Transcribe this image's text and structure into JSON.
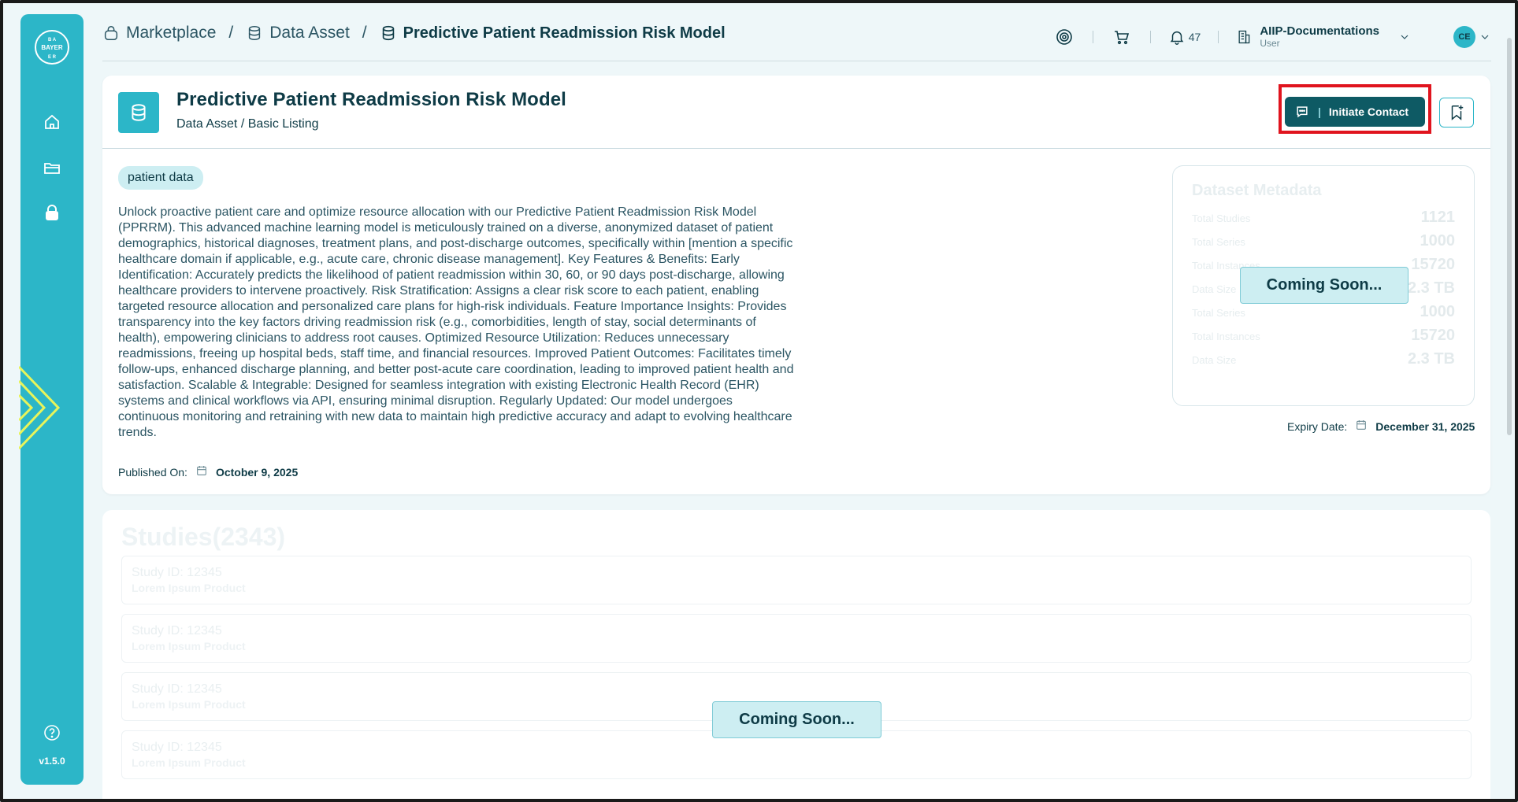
{
  "sidebar": {
    "logo_text": "BAYER",
    "icons": [
      "home-icon",
      "folder-icon",
      "marketplace-icon"
    ],
    "help_icon": "help-icon",
    "version": "v1.5.0"
  },
  "breadcrumb": {
    "items": [
      {
        "label": "Marketplace",
        "icon": "shopping-bag-icon"
      },
      {
        "label": "Data Asset",
        "icon": "database-icon"
      },
      {
        "label": "Predictive Patient Readmission Risk Model",
        "icon": "database-icon"
      }
    ],
    "separator": "/"
  },
  "topbar": {
    "notifications_count": "47",
    "org_name": "AIIP-Documentations",
    "org_role": "User",
    "avatar_initials": "CE"
  },
  "asset": {
    "title": "Predictive Patient Readmission Risk Model",
    "subtitle": "Data Asset / Basic Listing",
    "contact_label": "Initiate Contact",
    "tag": "patient data",
    "description": "Unlock proactive patient care and optimize resource allocation with our Predictive Patient Readmission Risk Model (PPRRM). This advanced machine learning model is meticulously trained on a diverse, anonymized dataset of patient demographics, historical diagnoses, treatment plans, and post-discharge outcomes, specifically within [mention a specific healthcare domain if applicable, e.g., acute care, chronic disease management]. Key Features & Benefits: Early Identification: Accurately predicts the likelihood of patient readmission within 30, 60, or 90 days post-discharge, allowing healthcare providers to intervene proactively. Risk Stratification: Assigns a clear risk score to each patient, enabling targeted resource allocation and personalized care plans for high-risk individuals. Feature Importance Insights: Provides transparency into the key factors driving readmission risk (e.g., comorbidities, length of stay, social determinants of health), empowering clinicians to address root causes. Optimized Resource Utilization: Reduces unnecessary readmissions, freeing up hospital beds, staff time, and financial resources. Improved Patient Outcomes: Facilitates timely follow-ups, enhanced discharge planning, and better post-acute care coordination, leading to improved patient health and satisfaction. Scalable & Integrable: Designed for seamless integration with existing Electronic Health Record (EHR) systems and clinical workflows via API, ensuring minimal disruption. Regularly Updated: Our model undergoes continuous monitoring and retraining with new data to maintain high predictive accuracy and adapt to evolving healthcare trends.",
    "published_label": "Published On:",
    "published_date": "October 9, 2025",
    "expiry_label": "Expiry Date:",
    "expiry_date": "December 31, 2025"
  },
  "metadata": {
    "title": "Dataset Metadata",
    "rows": [
      {
        "label": "Total Studies",
        "value": "1121"
      },
      {
        "label": "Total Series",
        "value": "1000"
      },
      {
        "label": "Total Instances",
        "value": "15720"
      },
      {
        "label": "Data Size",
        "value": "2.3 TB"
      },
      {
        "label": "Total Series",
        "value": "1000"
      },
      {
        "label": "Total Instances",
        "value": "15720"
      },
      {
        "label": "Data Size",
        "value": "2.3 TB"
      }
    ],
    "coming_soon": "Coming Soon..."
  },
  "studies": {
    "title": "Studies(2343)",
    "items": [
      {
        "id": "Study ID: 12345",
        "product": "Lorem Ipsum Product"
      },
      {
        "id": "Study ID: 12345",
        "product": "Lorem Ipsum Product"
      },
      {
        "id": "Study ID: 12345",
        "product": "Lorem Ipsum Product"
      },
      {
        "id": "Study ID: 12345",
        "product": "Lorem Ipsum Product"
      }
    ],
    "coming_soon": "Coming Soon..."
  },
  "colors": {
    "brand": "#2cb6c8",
    "primary_dark": "#0e5a64",
    "highlight": "#e0141e"
  }
}
